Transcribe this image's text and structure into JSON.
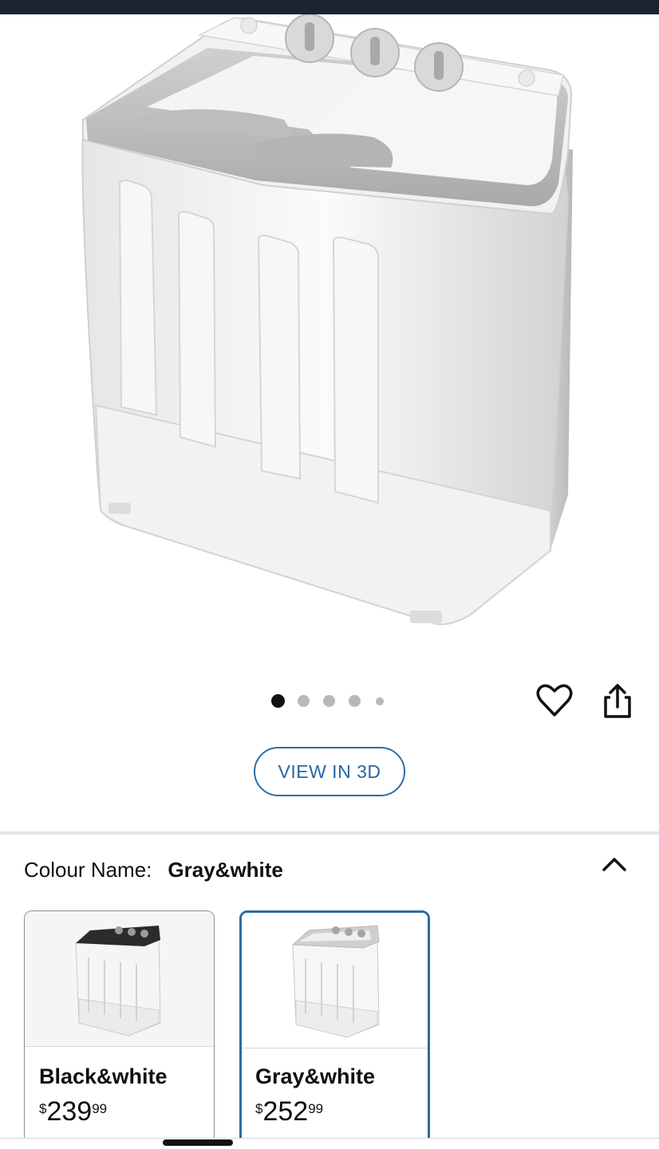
{
  "product": {
    "image_alt": "Twin tub portable washing machine",
    "carousel": {
      "count": 5,
      "active_index": 0
    },
    "view_3d_label": "VIEW IN 3D"
  },
  "colour": {
    "label": "Colour Name:",
    "selected": "Gray&white"
  },
  "variants": [
    {
      "name": "Black&white",
      "price_symbol": "$",
      "price_whole": "239",
      "price_fraction": "99",
      "selected": false
    },
    {
      "name": "Gray&white",
      "price_symbol": "$",
      "price_whole": "252",
      "price_fraction": "99",
      "selected": true
    }
  ],
  "colors": {
    "accent_blue": "#2f6da5",
    "top_bar": "#1b2430",
    "dot_active": "#111111",
    "dot_inactive": "#b8b8b8"
  },
  "icons": {
    "wishlist": "heart-icon",
    "share": "share-icon",
    "collapse": "chevron-up-icon"
  }
}
